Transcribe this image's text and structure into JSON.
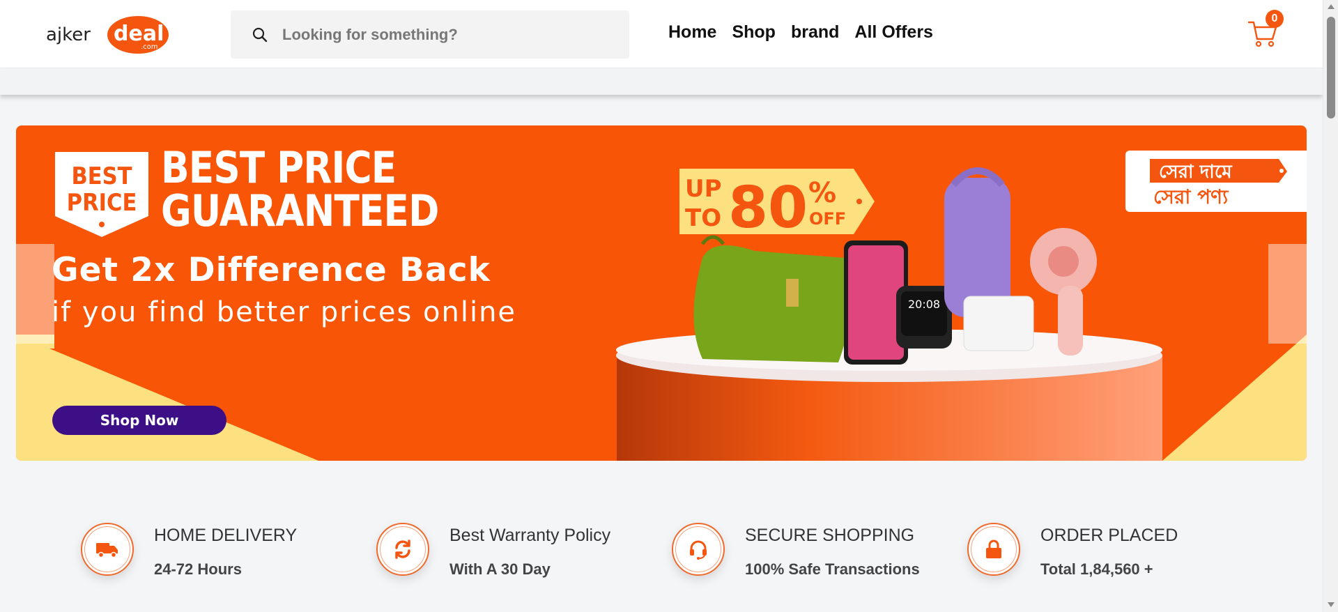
{
  "header": {
    "logo_text_left": "ajker",
    "logo_text_right": "deal",
    "logo_domain": ".com",
    "search_placeholder": "Looking for something?",
    "nav": [
      "Home",
      "Shop",
      "brand",
      "All Offers"
    ],
    "cart_count": "0"
  },
  "banner": {
    "badge_line1": "BEST",
    "badge_line2": "PRICE",
    "headline_line1": "BEST PRICE",
    "headline_line2": "GUARANTEED",
    "subheadline": "Get 2x Difference Back",
    "subtext": "if you find better prices online",
    "cta_label": "Shop Now",
    "offer_up": "UP",
    "offer_to": "TO",
    "offer_value": "80",
    "offer_percent": "%",
    "offer_off": "OFF",
    "bangla_line1": "সেরা দামে",
    "bangla_line2": "সেরা পণ্য",
    "watch_time": "20:08"
  },
  "features": [
    {
      "icon": "truck-icon",
      "title": "HOME DELIVERY",
      "subtitle": "24-72 Hours"
    },
    {
      "icon": "refresh-icon",
      "title": "Best Warranty Policy",
      "subtitle": "With A 30 Day"
    },
    {
      "icon": "headset-icon",
      "title": "SECURE SHOPPING",
      "subtitle": "100% Safe Transactions"
    },
    {
      "icon": "lock-icon",
      "title": "ORDER PLACED",
      "subtitle": "Total 1,84,560 +"
    }
  ],
  "colors": {
    "brand": "#f45610",
    "banner": "#f95506",
    "cta": "#3d0f86",
    "accent_yellow": "#fde080"
  }
}
